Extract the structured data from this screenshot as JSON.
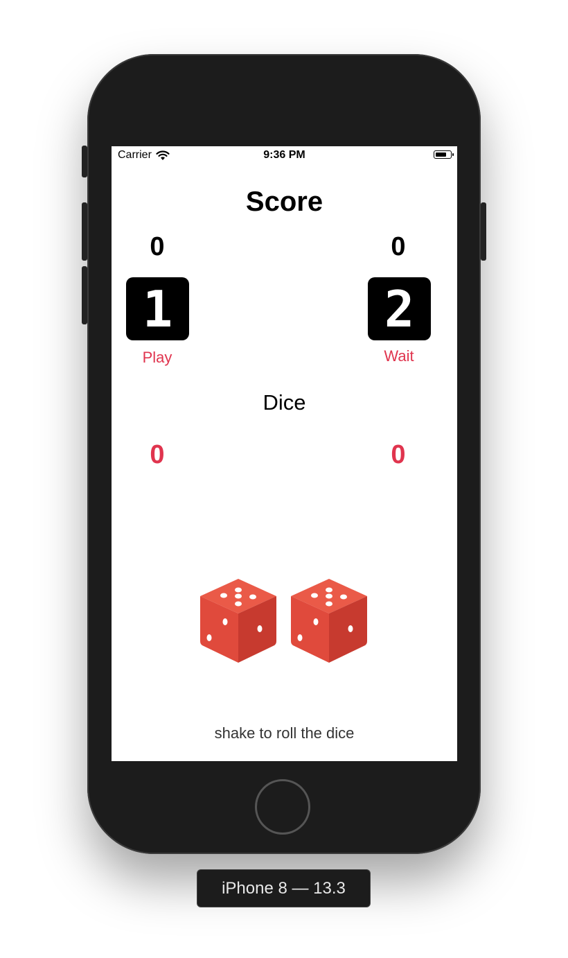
{
  "device": {
    "label": "iPhone 8 — 13.3"
  },
  "status_bar": {
    "carrier": "Carrier",
    "time": "9:36 PM",
    "icons": [
      "wifi-icon",
      "battery-icon"
    ]
  },
  "app": {
    "title": "Score",
    "players": [
      {
        "score": "0",
        "number": "1",
        "status": "Play"
      },
      {
        "score": "0",
        "number": "2",
        "status": "Wait"
      }
    ],
    "dice_label": "Dice",
    "dice_values": [
      "0",
      "0"
    ],
    "dice_icon": "two-red-dice-icon",
    "hint": "shake to roll the dice"
  },
  "colors": {
    "accent": "#e0344e",
    "dice": "#e04a3c",
    "phone_body": "#1c1c1c"
  }
}
